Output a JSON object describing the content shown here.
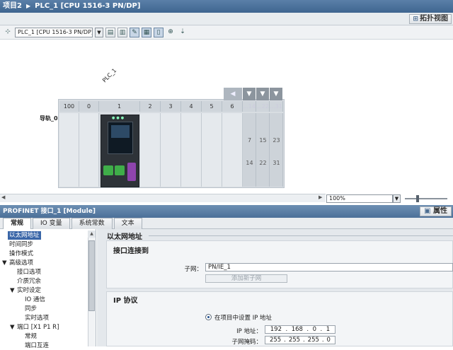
{
  "title_bar": {
    "project": "项目2",
    "device": "PLC_1 [CPU 1516-3 PN/DP]"
  },
  "view_header": {
    "topology_button": "拓扑视图"
  },
  "toolbar": {
    "device_selector": "PLC_1 [CPU 1516-3 PN/DP]"
  },
  "device_view": {
    "plc_label": "PLC_1",
    "rack_label": "导轨_0",
    "slots": [
      "100",
      "0",
      "1",
      "2",
      "3",
      "4",
      "5",
      "6",
      "...14",
      "...22",
      "...31"
    ],
    "extension_columns": [
      [
        "7",
        "14"
      ],
      [
        "15",
        "22"
      ],
      [
        "23",
        "31"
      ]
    ],
    "zoom": "100%"
  },
  "inspector": {
    "title": "PROFINET 接口_1 [Module]",
    "properties_button": "属性",
    "tabs": [
      "常规",
      "IO 变量",
      "系统常数",
      "文本"
    ],
    "nav": [
      "以太网地址",
      "时间同步",
      "操作模式",
      "高级选项",
      "接口选项",
      "介质冗余",
      "实时设定",
      "IO 通信",
      "同步",
      "实时选项",
      "端口 [X1 P1 R]",
      "常规",
      "端口互连"
    ]
  },
  "content": {
    "section_title": "以太网地址",
    "interface_group": {
      "title": "接口连接到",
      "subnet_label": "子网：",
      "subnet_value": "PN/IE_1",
      "add_subnet_button": "添加新子网"
    },
    "ip_group": {
      "title": "IP 协议",
      "radio_label": "在项目中设置 IP 地址",
      "ip_label": "IP 地址：",
      "ip": [
        "192",
        "168",
        "0",
        "1"
      ],
      "mask_label": "子网掩码：",
      "mask": [
        "255",
        "255",
        "255",
        "0"
      ]
    }
  },
  "colors": {
    "title_bar": "#4a7099",
    "nav_selected": "#3a66a8",
    "cpu_body": "#2e3338"
  }
}
